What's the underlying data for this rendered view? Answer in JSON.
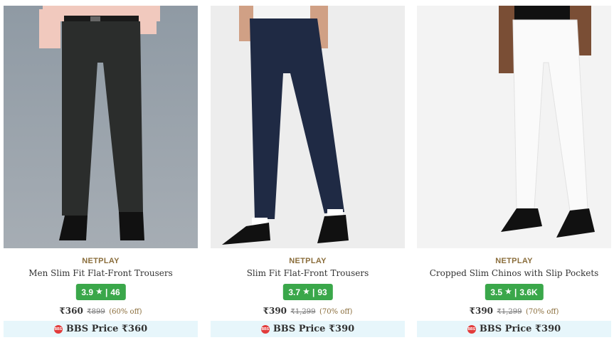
{
  "products": [
    {
      "brand": "NETPLAY",
      "title": "Men Slim Fit Flat-Front Trousers",
      "rating": "3.9",
      "rating_count": "46",
      "price": "₹360",
      "mrp": "₹899",
      "discount": "(60% off)",
      "bbs_label": "BBS Price ₹360"
    },
    {
      "brand": "NETPLAY",
      "title": "Slim Fit Flat-Front Trousers",
      "rating": "3.7",
      "rating_count": "93",
      "price": "₹390",
      "mrp": "₹1,299",
      "discount": "(70% off)",
      "bbs_label": "BBS Price ₹390"
    },
    {
      "brand": "NETPLAY",
      "title": "Cropped Slim Chinos with Slip Pockets",
      "rating": "3.5",
      "rating_count": "3.6K",
      "price": "₹390",
      "mrp": "₹1,299",
      "discount": "(70% off)",
      "bbs_label": "BBS Price ₹390"
    }
  ],
  "colors": {
    "rating_bg": "#3aa74a",
    "brand": "#8a6d3b",
    "bbs_bg": "#e7f6fb",
    "bbs_icon": "#e23b3b"
  }
}
